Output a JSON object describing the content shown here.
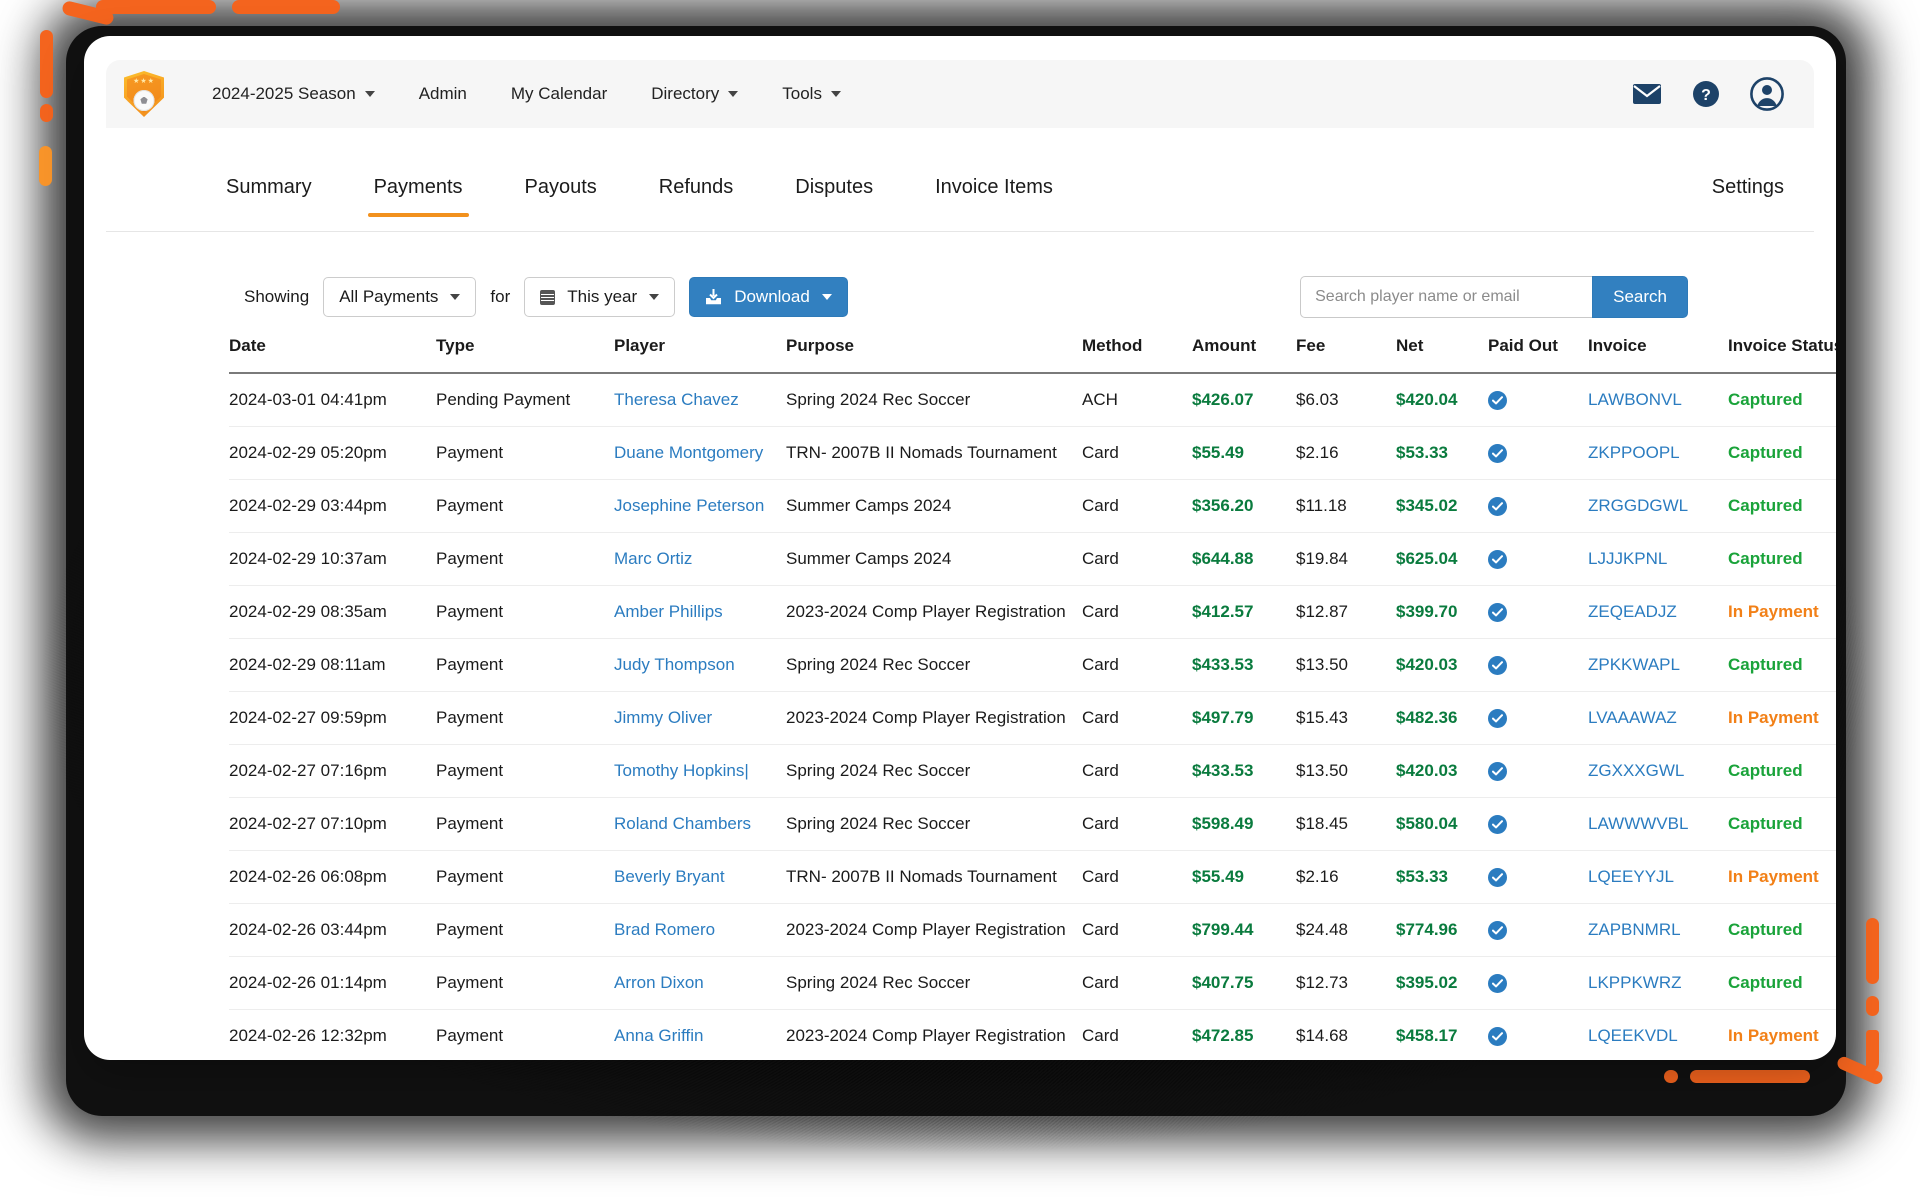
{
  "topnav": {
    "logo_alt": "soccer-shield-logo",
    "links": [
      {
        "label": "2024-2025 Season",
        "caret": true
      },
      {
        "label": "Admin",
        "caret": false
      },
      {
        "label": "My Calendar",
        "caret": false
      },
      {
        "label": "Directory",
        "caret": true
      },
      {
        "label": "Tools",
        "caret": true
      }
    ],
    "right_icons": [
      "mail-icon",
      "help-icon",
      "account-avatar-icon"
    ]
  },
  "tabs": [
    {
      "label": "Summary",
      "active": false
    },
    {
      "label": "Payments",
      "active": true
    },
    {
      "label": "Payouts",
      "active": false
    },
    {
      "label": "Refunds",
      "active": false
    },
    {
      "label": "Disputes",
      "active": false
    },
    {
      "label": "Invoice Items",
      "active": false
    }
  ],
  "settings_label": "Settings",
  "toolbar": {
    "showing_label": "Showing",
    "filter_value": "All Payments",
    "for_label": "for",
    "period_value": "This year",
    "download_label": "Download"
  },
  "search": {
    "placeholder": "Search player name or email",
    "value": "",
    "button_label": "Search"
  },
  "table": {
    "columns": [
      "Date",
      "Type",
      "Player",
      "Purpose",
      "Method",
      "Amount",
      "Fee",
      "Net",
      "Paid Out",
      "Invoice",
      "Invoice Status"
    ],
    "rows": [
      {
        "date": "2024-03-01 04:41pm",
        "type": "Pending Payment",
        "player": "Theresa Chavez",
        "purpose": "Spring 2024 Rec Soccer",
        "method": "ACH",
        "amount": "$426.07",
        "fee": "$6.03",
        "net": "$420.04",
        "paid_out": true,
        "invoice": "LAWBONVL",
        "status": "Captured"
      },
      {
        "date": "2024-02-29 05:20pm",
        "type": "Payment",
        "player": "Duane Montgomery",
        "purpose": "TRN- 2007B II Nomads Tournament",
        "method": "Card",
        "amount": "$55.49",
        "fee": "$2.16",
        "net": "$53.33",
        "paid_out": true,
        "invoice": "ZKPPOOPL",
        "status": "Captured"
      },
      {
        "date": "2024-02-29 03:44pm",
        "type": "Payment",
        "player": "Josephine Peterson",
        "purpose": "Summer Camps 2024",
        "method": "Card",
        "amount": "$356.20",
        "fee": "$11.18",
        "net": "$345.02",
        "paid_out": true,
        "invoice": "ZRGGDGWL",
        "status": "Captured"
      },
      {
        "date": "2024-02-29 10:37am",
        "type": "Payment",
        "player": "Marc Ortiz",
        "purpose": "Summer Camps 2024",
        "method": "Card",
        "amount": "$644.88",
        "fee": "$19.84",
        "net": "$625.04",
        "paid_out": true,
        "invoice": "LJJJKPNL",
        "status": "Captured"
      },
      {
        "date": "2024-02-29 08:35am",
        "type": "Payment",
        "player": "Amber Phillips",
        "purpose": "2023-2024 Comp Player Registration",
        "method": "Card",
        "amount": "$412.57",
        "fee": "$12.87",
        "net": "$399.70",
        "paid_out": true,
        "invoice": "ZEQEADJZ",
        "status": "In Payment"
      },
      {
        "date": "2024-02-29 08:11am",
        "type": "Payment",
        "player": "Judy Thompson",
        "purpose": "Spring 2024 Rec Soccer",
        "method": "Card",
        "amount": "$433.53",
        "fee": "$13.50",
        "net": "$420.03",
        "paid_out": true,
        "invoice": "ZPKKWAPL",
        "status": "Captured"
      },
      {
        "date": "2024-02-27 09:59pm",
        "type": "Payment",
        "player": "Jimmy Oliver",
        "purpose": "2023-2024 Comp Player Registration",
        "method": "Card",
        "amount": "$497.79",
        "fee": "$15.43",
        "net": "$482.36",
        "paid_out": true,
        "invoice": "LVAAAWAZ",
        "status": "In Payment"
      },
      {
        "date": "2024-02-27 07:16pm",
        "type": "Payment",
        "player": "Tomothy Hopkins|",
        "purpose": "Spring 2024 Rec Soccer",
        "method": "Card",
        "amount": "$433.53",
        "fee": "$13.50",
        "net": "$420.03",
        "paid_out": true,
        "invoice": "ZGXXXGWL",
        "status": "Captured"
      },
      {
        "date": "2024-02-27 07:10pm",
        "type": "Payment",
        "player": "Roland Chambers",
        "purpose": "Spring 2024 Rec Soccer",
        "method": "Card",
        "amount": "$598.49",
        "fee": "$18.45",
        "net": "$580.04",
        "paid_out": true,
        "invoice": "LAWWWVBL",
        "status": "Captured"
      },
      {
        "date": "2024-02-26 06:08pm",
        "type": "Payment",
        "player": "Beverly Bryant",
        "purpose": "TRN- 2007B II Nomads Tournament",
        "method": "Card",
        "amount": "$55.49",
        "fee": "$2.16",
        "net": "$53.33",
        "paid_out": true,
        "invoice": "LQEEYYJL",
        "status": "In Payment"
      },
      {
        "date": "2024-02-26 03:44pm",
        "type": "Payment",
        "player": "Brad Romero",
        "purpose": "2023-2024 Comp Player Registration",
        "method": "Card",
        "amount": "$799.44",
        "fee": "$24.48",
        "net": "$774.96",
        "paid_out": true,
        "invoice": "ZAPBNMRL",
        "status": "Captured"
      },
      {
        "date": "2024-02-26 01:14pm",
        "type": "Payment",
        "player": "Arron Dixon",
        "purpose": "Spring 2024 Rec Soccer",
        "method": "Card",
        "amount": "$407.75",
        "fee": "$12.73",
        "net": "$395.02",
        "paid_out": true,
        "invoice": "LKPPKWRZ",
        "status": "Captured"
      },
      {
        "date": "2024-02-26 12:32pm",
        "type": "Payment",
        "player": "Anna Griffin",
        "purpose": "2023-2024 Comp Player Registration",
        "method": "Card",
        "amount": "$472.85",
        "fee": "$14.68",
        "net": "$458.17",
        "paid_out": true,
        "invoice": "LQEEKVDL",
        "status": "In Payment"
      }
    ]
  },
  "colors": {
    "accent_orange": "#f2911d",
    "link_blue": "#2b7cc0",
    "button_blue": "#3280c0",
    "money_green": "#0a7b3e",
    "status_green": "#1aa33a",
    "status_orange": "#f28017",
    "marker_orange": "#f4641e"
  }
}
